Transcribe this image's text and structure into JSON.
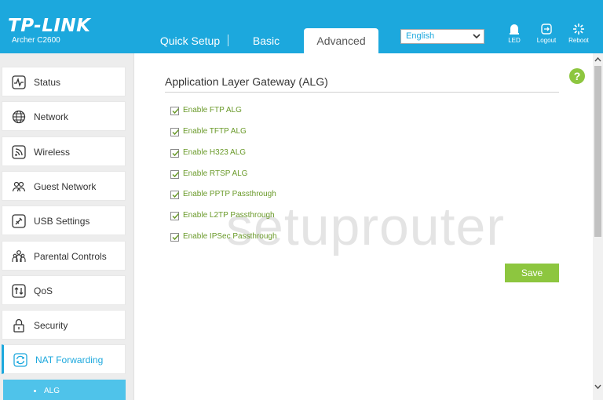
{
  "header": {
    "logo": "TP-LINK",
    "model": "Archer C2600",
    "tabs": [
      "Quick Setup",
      "Basic",
      "Advanced"
    ],
    "language": "English",
    "icons": [
      {
        "name": "led-icon",
        "label": "LED"
      },
      {
        "name": "logout-icon",
        "label": "Logout"
      },
      {
        "name": "reboot-icon",
        "label": "Reboot"
      }
    ]
  },
  "sidebar": {
    "items": [
      {
        "label": "Status",
        "icon": "status-icon"
      },
      {
        "label": "Network",
        "icon": "globe-icon"
      },
      {
        "label": "Wireless",
        "icon": "wireless-icon"
      },
      {
        "label": "Guest Network",
        "icon": "guest-network-icon"
      },
      {
        "label": "USB Settings",
        "icon": "usb-icon"
      },
      {
        "label": "Parental Controls",
        "icon": "parental-controls-icon"
      },
      {
        "label": "QoS",
        "icon": "qos-icon"
      },
      {
        "label": "Security",
        "icon": "lock-icon"
      },
      {
        "label": "NAT Forwarding",
        "icon": "nat-forwarding-icon"
      }
    ],
    "active_index": 8,
    "submenu": {
      "label": "ALG"
    }
  },
  "main": {
    "title": "Application Layer Gateway (ALG)",
    "help": "?",
    "options": [
      {
        "label": "Enable FTP ALG",
        "checked": true
      },
      {
        "label": "Enable TFTP ALG",
        "checked": true
      },
      {
        "label": "Enable H323 ALG",
        "checked": true
      },
      {
        "label": "Enable RTSP ALG",
        "checked": true
      },
      {
        "label": "Enable PPTP Passthrough",
        "checked": true
      },
      {
        "label": "Enable L2TP Passthrough",
        "checked": true
      },
      {
        "label": "Enable IPSec Passthrough",
        "checked": true
      }
    ],
    "save_label": "Save",
    "watermark": "setuprouter"
  },
  "colors": {
    "brand": "#1ca8dd",
    "accent_green": "#8dc63f",
    "label_green": "#6a9a2a"
  }
}
